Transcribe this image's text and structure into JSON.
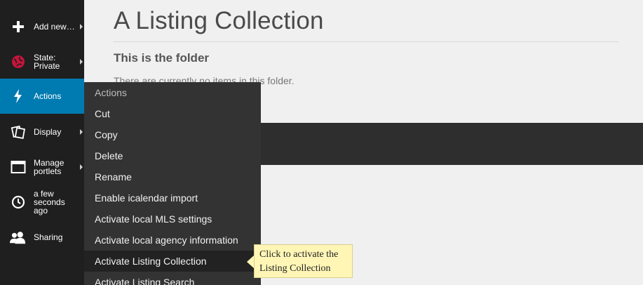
{
  "toolbar": {
    "items": [
      {
        "label": "Add new…",
        "icon": "plus-icon",
        "submenu": true
      },
      {
        "label": "State: Private",
        "icon": "state-icon",
        "submenu": true,
        "state_color": "#c4153a"
      },
      {
        "label": "Actions",
        "icon": "bolt-icon",
        "submenu": true,
        "active": true
      },
      {
        "label": "Display",
        "icon": "display-icon",
        "submenu": true
      },
      {
        "label": "Manage portlets",
        "icon": "portlets-icon",
        "submenu": true
      },
      {
        "label": "a few seconds ago",
        "icon": "clock-icon",
        "submenu": false
      },
      {
        "label": "Sharing",
        "icon": "users-icon",
        "submenu": false
      }
    ],
    "active_color": "#007bb1"
  },
  "main": {
    "title": "A Listing Collection",
    "description": "This is the folder",
    "note": "There are currently no items in this folder."
  },
  "actions_menu": {
    "header": "Actions",
    "items": [
      "Cut",
      "Copy",
      "Delete",
      "Rename",
      "Enable icalendar import",
      "Activate local MLS settings",
      "Activate local agency information",
      "Activate Listing Collection",
      "Activate Listing Search"
    ],
    "hovered": "Activate Listing Collection"
  },
  "tooltip": {
    "line1": "Click to activate the",
    "line2": "Listing Collection"
  }
}
